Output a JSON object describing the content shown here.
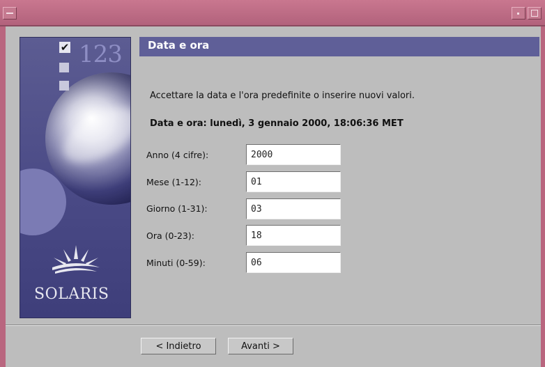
{
  "header": {
    "title": "Data e ora"
  },
  "intro": "Accettare la data e l'ora predefinite o inserire nuovi valori.",
  "current_datetime": "Data e ora: lunedì, 3 gennaio 2000, 18:06:36 MET",
  "fields": [
    {
      "label": "Anno   (4 cifre):",
      "value": "2000"
    },
    {
      "label": "Mese   (1-12):",
      "value": "01"
    },
    {
      "label": "Giorno (1-31):",
      "value": "03"
    },
    {
      "label": "Ora    (0-23):",
      "value": "18"
    },
    {
      "label": "Minuti (0-59):",
      "value": "06"
    }
  ],
  "side": {
    "step_number": "123",
    "brand": "SOLARIS"
  },
  "buttons": {
    "back": "< Indietro",
    "next": "Avanti >"
  },
  "colors": {
    "title_bar": "#b9667f",
    "header_bar": "#5f5f98",
    "panel": "#4a4a86",
    "background": "#bdbdbd"
  },
  "icons": [
    "window-menu-icon",
    "minimize-icon",
    "maximize-icon",
    "checkmark-icon",
    "sun-logo-icon"
  ]
}
